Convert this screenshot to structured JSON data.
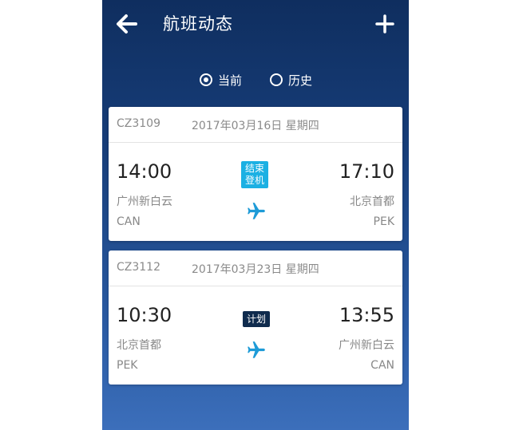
{
  "header": {
    "title": "航班动态"
  },
  "filter": {
    "options": [
      {
        "label": "当前",
        "selected": true
      },
      {
        "label": "历史",
        "selected": false
      }
    ]
  },
  "flights": [
    {
      "flight_no": "CZ3109",
      "date": "2017年03月16日 星期四",
      "departure": {
        "time": "14:00",
        "city": "广州新白云",
        "code": "CAN"
      },
      "arrival": {
        "time": "17:10",
        "city": "北京首都",
        "code": "PEK"
      },
      "status_line1": "结束",
      "status_line2": "登机",
      "status_color": "#1bb0e3"
    },
    {
      "flight_no": "CZ3112",
      "date": "2017年03月23日 星期四",
      "departure": {
        "time": "10:30",
        "city": "北京首都",
        "code": "PEK"
      },
      "arrival": {
        "time": "13:55",
        "city": "广州新白云",
        "code": "CAN"
      },
      "status": "计划",
      "status_color": "#0f2b4d"
    }
  ],
  "colors": {
    "background_top": "#0f2e5f",
    "background_bottom": "#3c6fbb",
    "plane_icon": "#1e9bd7"
  }
}
